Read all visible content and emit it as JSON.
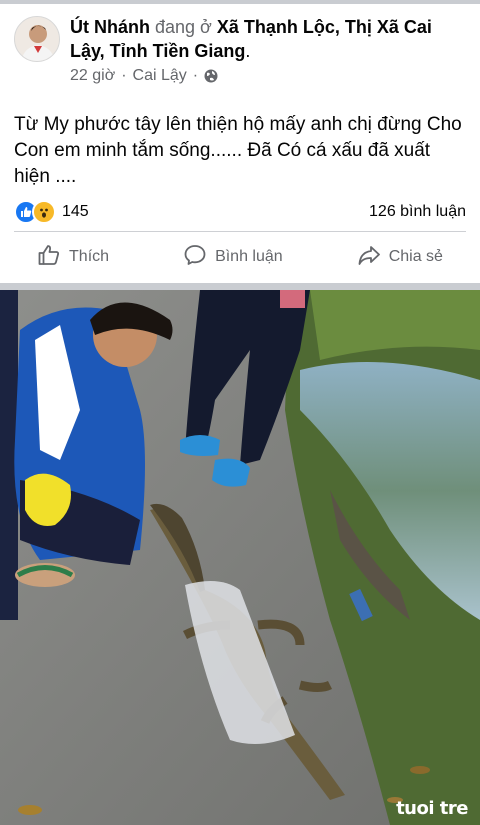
{
  "post": {
    "author": "Út Nhánh",
    "action_text": "đang ở",
    "location": "Xã Thạnh Lộc, Thị Xã Cai Lậy, Tỉnh Tiền Giang",
    "location_suffix": ".",
    "time": "22 giờ",
    "meta_separator": "·",
    "place": "Cai Lậy",
    "meta_separator_2": "·",
    "privacy_icon": "globe-icon",
    "text": "Từ My phước tây lên thiện hộ mấy anh chị đừng Cho Con em minh tắm sống...... Đã Có cá xấu đã xuất hiện ...."
  },
  "reactions": {
    "icons": [
      "like-icon",
      "wow-icon"
    ],
    "count": "145",
    "comments": "126 bình luận"
  },
  "actions": {
    "like_label": "Thích",
    "comment_label": "Bình luận",
    "share_label": "Chia sẻ"
  },
  "photo": {
    "watermark": "tuoi tre"
  },
  "colors": {
    "like_blue": "#1877f2",
    "wow_yellow": "#f7b928",
    "secondary_text": "#65676b",
    "separator": "#c9ccd1"
  }
}
